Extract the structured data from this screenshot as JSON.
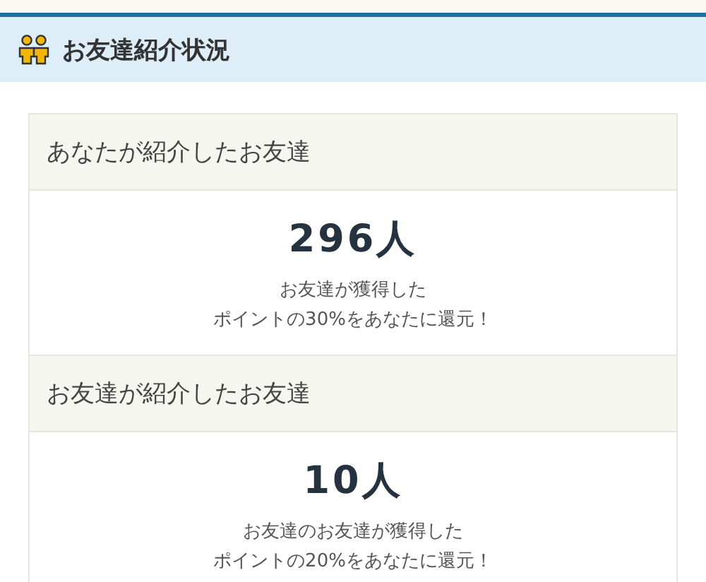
{
  "header": {
    "title": "お友達紹介状況"
  },
  "sections": [
    {
      "title": "あなたが紹介したお友達",
      "count": "296人",
      "description_lines": [
        "お友達が獲得した",
        "ポイントの30%をあなたに還元！"
      ]
    },
    {
      "title": "お友達が紹介したお友達",
      "count": "10人",
      "description_lines": [
        "お友達のお友達が獲得した",
        "ポイントの20%をあなたに還元！"
      ]
    }
  ]
}
